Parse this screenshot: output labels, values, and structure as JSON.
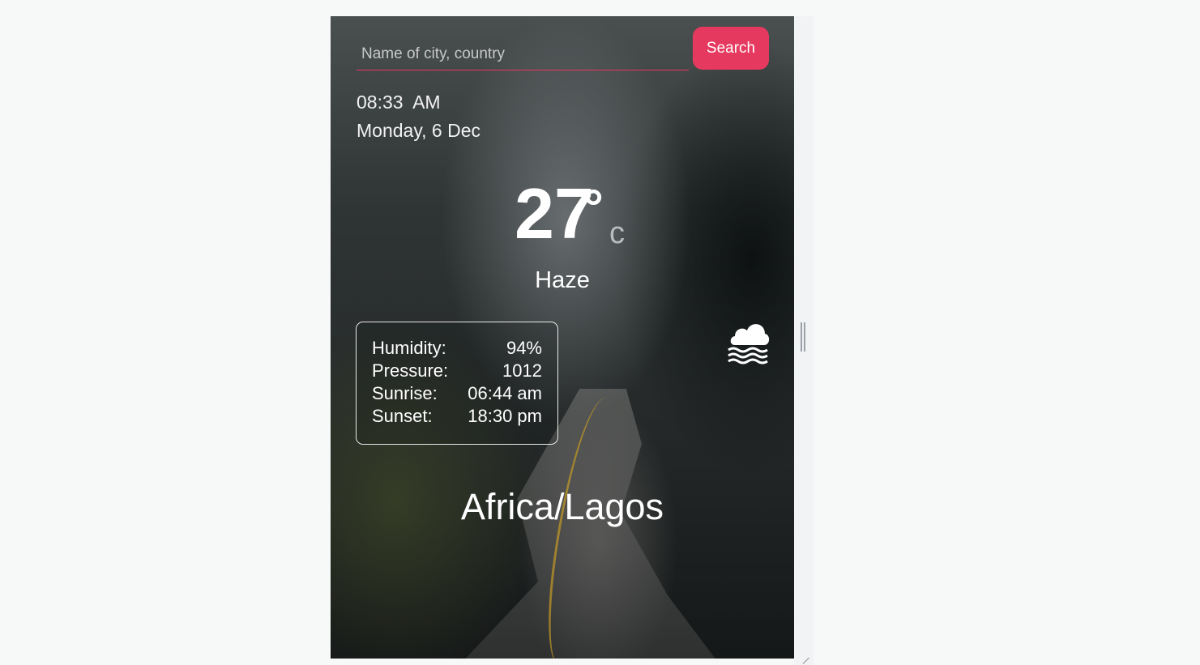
{
  "search": {
    "placeholder": "Name of city, country",
    "button_label": "Search"
  },
  "clock": {
    "time": "08:33  AM",
    "date": "Monday, 6 Dec"
  },
  "current": {
    "temperature": "27",
    "degree_symbol": "°",
    "unit": "c",
    "condition": "Haze",
    "icon": "fog-icon"
  },
  "details": [
    {
      "label": "Humidity:",
      "value": "94%"
    },
    {
      "label": "Pressure:",
      "value": "1012"
    },
    {
      "label": "Sunrise:",
      "value": "06:44 am"
    },
    {
      "label": "Sunset:",
      "value": "18:30 pm"
    }
  ],
  "location": "Africa/Lagos",
  "colors": {
    "accent": "#e6395f",
    "text": "#ffffff",
    "page_background": "#f7f8f8"
  }
}
